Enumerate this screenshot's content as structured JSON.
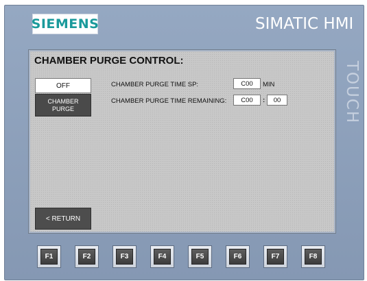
{
  "device": {
    "brand": "SIEMENS",
    "model": "SIMATIC HMI",
    "side_label": "TOUCH"
  },
  "screen": {
    "title": "CHAMBER PURGE CONTROL:",
    "off_button": "OFF",
    "purge_button_line1": "CHAMBER",
    "purge_button_line2": "PURGE",
    "return_button": "< RETURN",
    "purge_time_sp_label": "CHAMBER PURGE TIME SP:",
    "purge_time_sp_value": "C00",
    "purge_time_sp_unit": "MIN",
    "purge_time_remaining_label": "CHAMBER PURGE TIME REMAINING:",
    "purge_time_remaining_min": "C00",
    "time_separator": ":",
    "purge_time_remaining_sec": "00"
  },
  "function_keys": [
    "F1",
    "F2",
    "F3",
    "F4",
    "F5",
    "F6",
    "F7",
    "F8"
  ],
  "colors": {
    "bezel": "#8b9eb8",
    "brand": "#1a9a9b",
    "screen_bg": "#c8c8c8",
    "dark_button": "#4a4a4a"
  }
}
